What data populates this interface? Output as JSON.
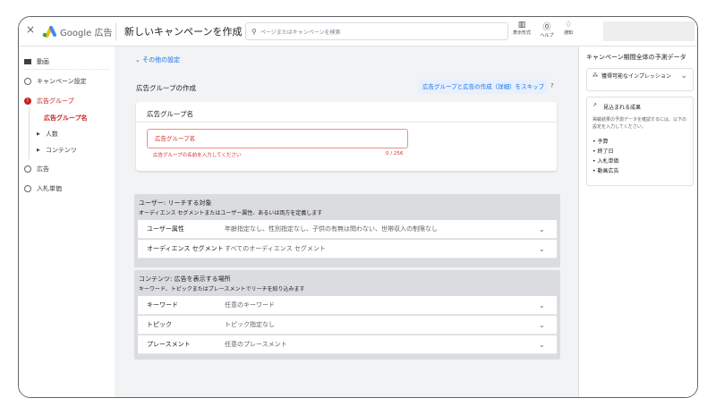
{
  "header": {
    "close": "×",
    "brand": "Google 広告",
    "title": "新しいキャンペーンを作成",
    "search_placeholder": "ページまたはキャンペーンを検索",
    "actions": [
      {
        "label": "表示形式",
        "icon": "layout-icon"
      },
      {
        "label": "ヘルプ",
        "icon": "help-icon"
      },
      {
        "label": "通知",
        "icon": "bell-icon"
      }
    ]
  },
  "sidebar": {
    "items": [
      {
        "label": "動画"
      },
      {
        "label": "キャンペーン設定"
      },
      {
        "label": "広告グループ"
      },
      {
        "label": "広告グループ名"
      },
      {
        "label": "人数"
      },
      {
        "label": "コンテンツ"
      },
      {
        "label": "広告"
      },
      {
        "label": "入札単価"
      }
    ]
  },
  "main": {
    "other_settings": "その他の設定",
    "create_title": "広告グループの作成",
    "skip_link": "広告グループと広告の作成（詳細）をスキップ",
    "name_card": {
      "title": "広告グループ名",
      "placeholder": "広告グループ名",
      "error": "広告グループの名前を入力してください",
      "counter": "0 / 256"
    },
    "users": {
      "title": "ユーザー: リーチする対象",
      "subtitle": "オーディエンス セグメントまたはユーザー属性、あるいは両方を定義します",
      "rows": [
        {
          "label": "ユーザー属性",
          "value": "年齢指定なし、性別指定なし、子供の有無は問わない、世帯収入の制限なし"
        },
        {
          "label": "オーディエンス セグメント",
          "value": "すべてのオーディエンス セグメント"
        }
      ]
    },
    "content": {
      "title": "コンテンツ: 広告を表示する場所",
      "subtitle": "キーワード、トピックまたはプレースメントでリーチを絞り込みます",
      "rows": [
        {
          "label": "キーワード",
          "value": "任意のキーワード"
        },
        {
          "label": "トピック",
          "value": "トピック指定なし"
        },
        {
          "label": "プレースメント",
          "value": "任意のプレースメント"
        }
      ]
    }
  },
  "right": {
    "title": "キャンペーン期間全体の予測データ",
    "impressions": "獲得可能なインプレッション",
    "results_title": "見込まれる成果",
    "results_desc": "掲載結果の予測データを確認するには、以下の設定を入力してください。",
    "bullets": [
      "予算",
      "終了日",
      "入札単価",
      "動画広告"
    ]
  },
  "colors": {
    "error": "#c5221f",
    "link": "#1a73e8"
  }
}
